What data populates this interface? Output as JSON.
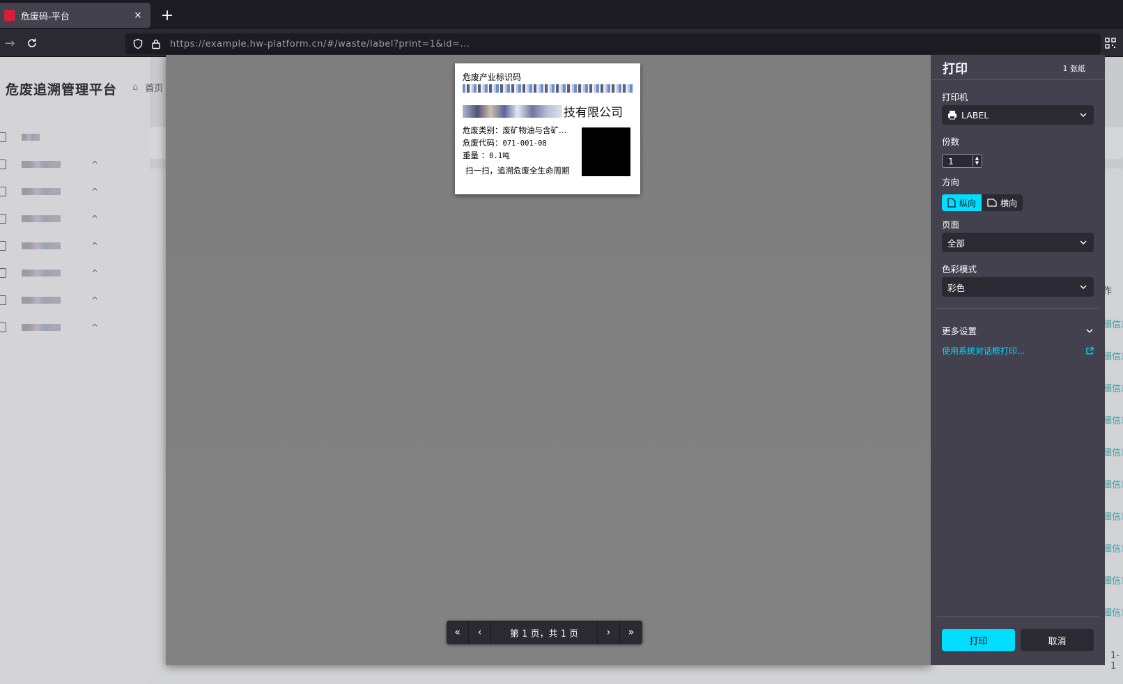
{
  "browser": {
    "tab_title": "危废码-平台",
    "tab_close": "×",
    "new_tab": "+",
    "url": "https://example.hw-platform.cn/#/waste/label?print=1&id=...",
    "back_glyph": "→",
    "reload_glyph": "⟳"
  },
  "app": {
    "logo_text": "危废追溯管理平台",
    "breadcrumb_home": "首页",
    "menu_chevron": "^",
    "column_header": "作",
    "row_link": "细信息",
    "pager_total": "1-1"
  },
  "label": {
    "title": "危废产业标识码",
    "company_suffix": "技有限公司",
    "category_key": "危废类别：",
    "category_val": "废矿物油与含矿…",
    "code_key": "危废代码：",
    "code_val": "071-001-08",
    "weight_key": "重量      ：",
    "weight_val": "0.1吨",
    "slogan": "扫一扫，追溯危废全生命周期"
  },
  "pager": {
    "first": "«",
    "prev": "‹",
    "text": "第 1 页，共 1 页",
    "next": "›",
    "last": "»"
  },
  "print_panel": {
    "title": "打印",
    "sheets": "1 张纸",
    "printer_label": "打印机",
    "printer_value": "LABEL",
    "copies_label": "份数",
    "copies_value": "1",
    "orientation_label": "方向",
    "orientation_portrait": "纵向",
    "orientation_landscape": "横向",
    "pages_label": "页面",
    "pages_value": "全部",
    "color_label": "色彩模式",
    "color_value": "彩色",
    "more_settings": "更多设置",
    "system_dialog": "使用系统对话框打印...",
    "print_button": "打印",
    "cancel_button": "取消"
  },
  "colors": {
    "accent": "#00ddff",
    "panel_bg": "#42414d",
    "chrome_bg": "#1c1b22"
  }
}
